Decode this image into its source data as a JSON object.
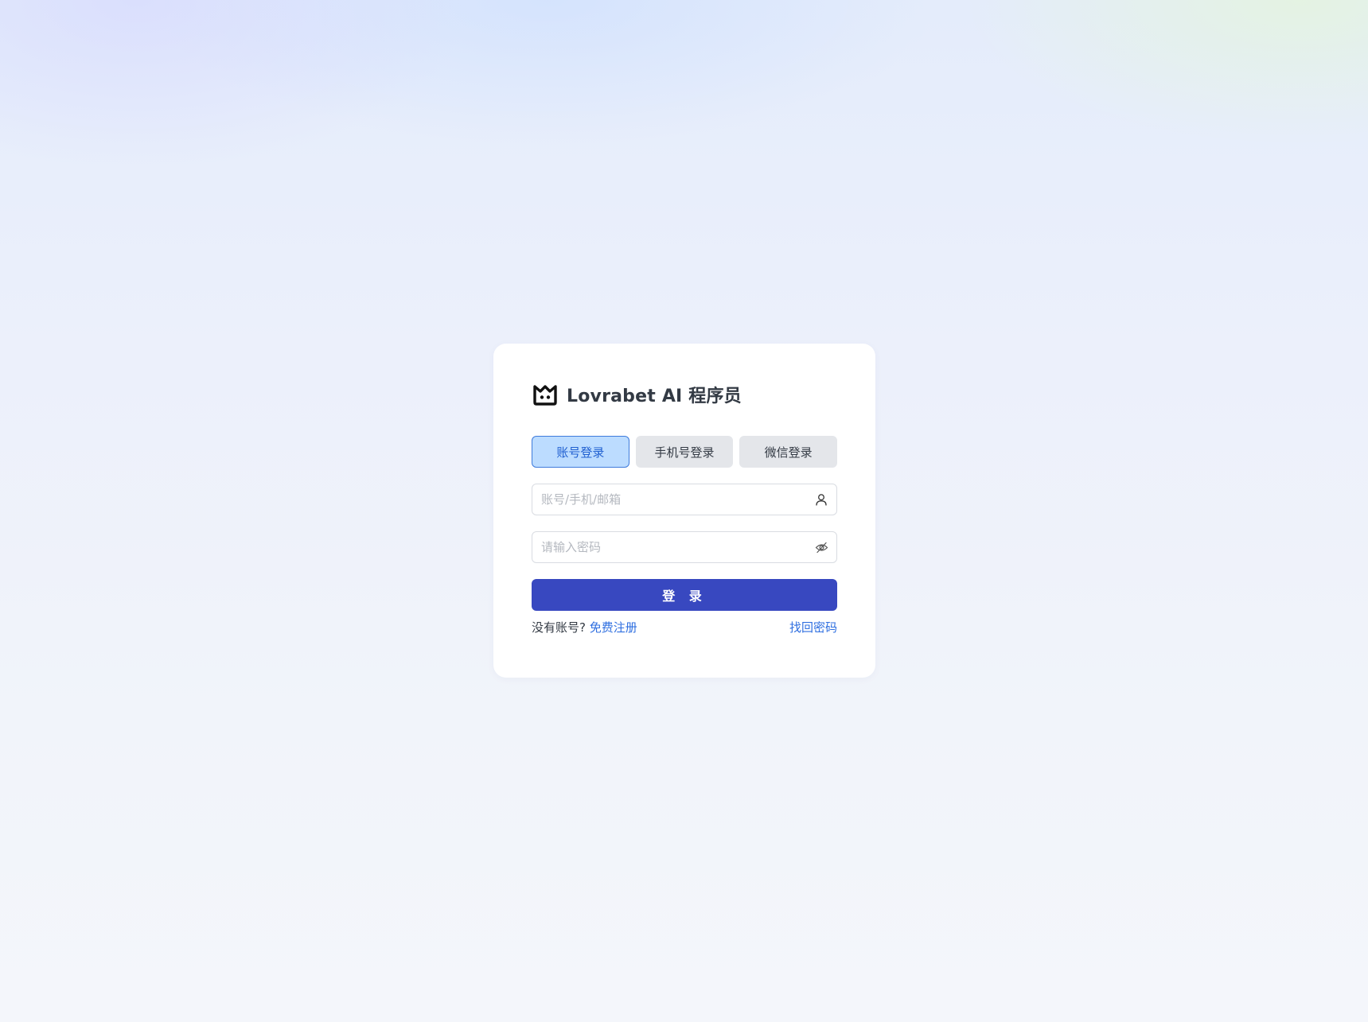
{
  "brand": {
    "logo_icon": "robot-logo-icon",
    "title": "Lovrabet AI 程序员"
  },
  "tabs": [
    {
      "label": "账号登录",
      "active": true
    },
    {
      "label": "手机号登录",
      "active": false
    },
    {
      "label": "微信登录",
      "active": false
    }
  ],
  "account_field": {
    "value": "",
    "placeholder": "账号/手机/邮箱",
    "icon": "user-icon"
  },
  "password_field": {
    "value": "",
    "placeholder": "请输入密码",
    "icon": "eye-off-icon"
  },
  "login_button": {
    "label": "登 录"
  },
  "footer": {
    "no_account_text": "没有账号?",
    "register_link": "免费注册",
    "forgot_link": "找回密码"
  },
  "colors": {
    "primary": "#3848c0",
    "link": "#2f6fe0",
    "active_tab_bg": "#bcdcff",
    "active_tab_border": "#3e7bdb"
  }
}
